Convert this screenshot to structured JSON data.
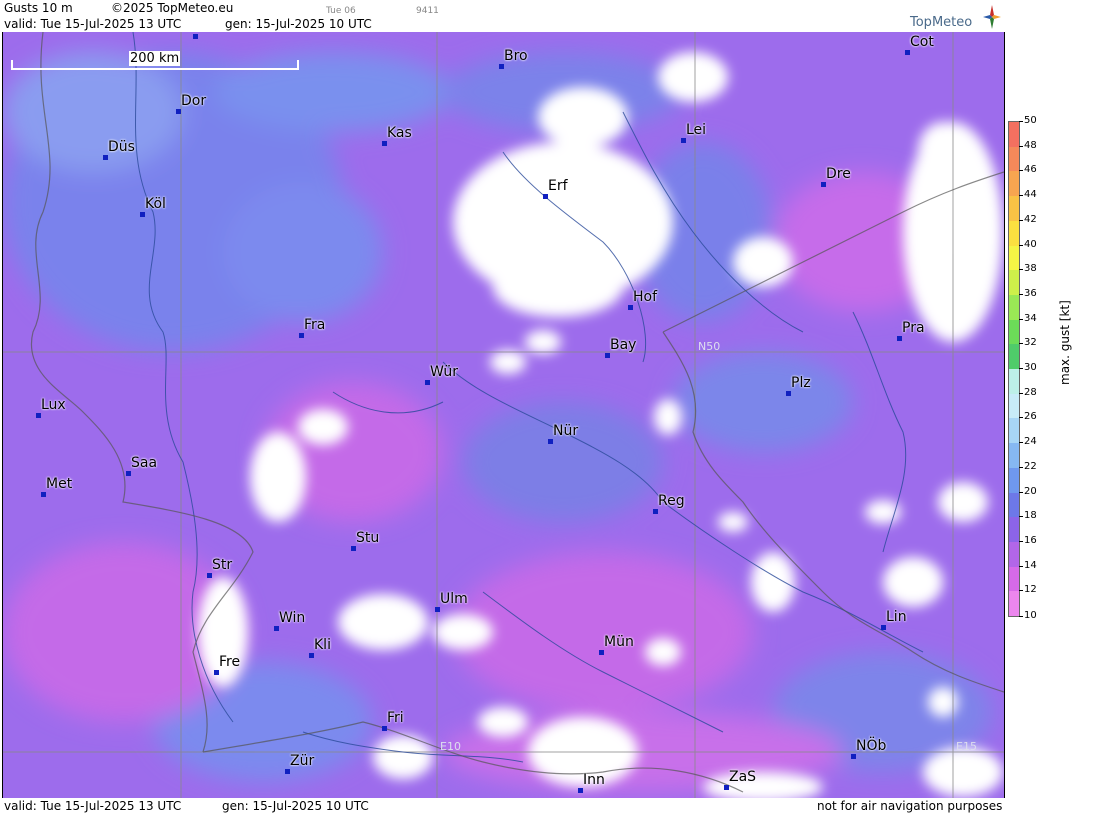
{
  "header": {
    "title": "Gusts 10 m",
    "copyright": "©2025 TopMeteo.eu",
    "run_day": "Tue 06",
    "code": "9411",
    "valid": "valid:  Tue  15-Jul-2025  13 UTC",
    "gen": "gen: 15-Jul-2025 10 UTC",
    "logo": "TopMeteo"
  },
  "footer": {
    "valid": "valid:  Tue  15-Jul-2025  13 UTC",
    "gen": "gen: 15-Jul-2025 10 UTC",
    "disclaimer": "not for air navigation purposes"
  },
  "map": {
    "scale_label": "200 km",
    "grid_labels": {
      "lat": "N50",
      "lon1": "E10",
      "lon2": "E15"
    },
    "cities": [
      {
        "name": "Mün"
      },
      {
        "name": "Bro"
      },
      {
        "name": "Cot"
      },
      {
        "name": "Dor"
      },
      {
        "name": "Kas"
      },
      {
        "name": "Lei"
      },
      {
        "name": "Düs"
      },
      {
        "name": "Dre"
      },
      {
        "name": "Erf"
      },
      {
        "name": "Köl"
      },
      {
        "name": "Hof"
      },
      {
        "name": "Fra"
      },
      {
        "name": "Pra"
      },
      {
        "name": "Bay"
      },
      {
        "name": "Wür"
      },
      {
        "name": "Plz"
      },
      {
        "name": "Lux"
      },
      {
        "name": "Nür"
      },
      {
        "name": "Saa"
      },
      {
        "name": "Met"
      },
      {
        "name": "Reg"
      },
      {
        "name": "Stu"
      },
      {
        "name": "Str"
      },
      {
        "name": "Ulm"
      },
      {
        "name": "Lin"
      },
      {
        "name": "Win"
      },
      {
        "name": "Mün"
      },
      {
        "name": "Kli"
      },
      {
        "name": "Fre"
      },
      {
        "name": "Fri"
      },
      {
        "name": "NÖb"
      },
      {
        "name": "Zür"
      },
      {
        "name": "Inn"
      },
      {
        "name": "ZaS"
      }
    ]
  },
  "legend": {
    "unit": "max. gust  [kt]",
    "ticks": [
      "50",
      "48",
      "46",
      "44",
      "42",
      "40",
      "38",
      "36",
      "34",
      "32",
      "30",
      "28",
      "26",
      "24",
      "22",
      "20",
      "18",
      "16",
      "14",
      "12",
      "10"
    ],
    "colors": [
      "#f47060",
      "#f5895a",
      "#f7a550",
      "#f9c245",
      "#fbe040",
      "#f5f545",
      "#cef04a",
      "#9ae855",
      "#6cdc58",
      "#4fcc6a",
      "#bdf0e8",
      "#c8ecf8",
      "#a8d6f6",
      "#86b8f2",
      "#6f98ee",
      "#6d78e8",
      "#8c64e8",
      "#b266e8",
      "#d66ae8",
      "#ec86ee"
    ]
  }
}
